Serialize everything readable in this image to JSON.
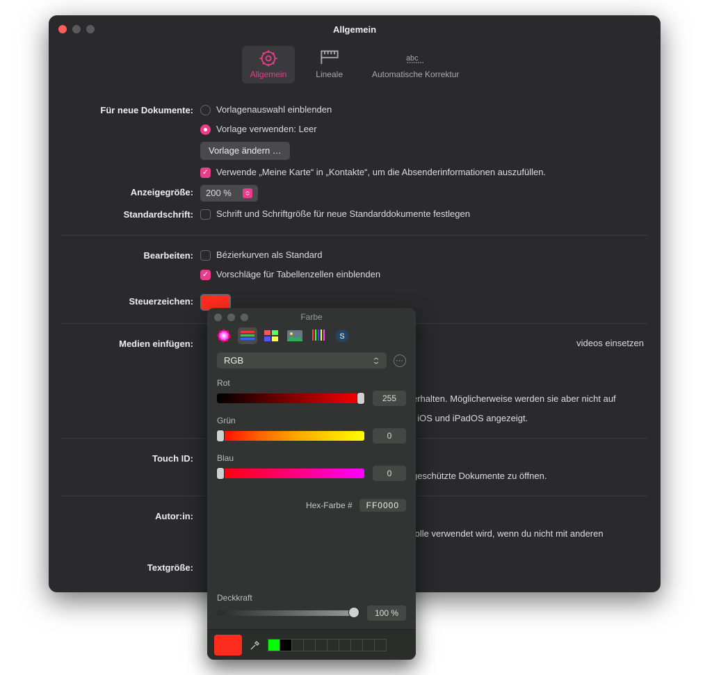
{
  "window": {
    "title": "Allgemein",
    "tabs": [
      {
        "id": "general",
        "label": "Allgemein"
      },
      {
        "id": "rulers",
        "label": "Lineale"
      },
      {
        "id": "autocorr",
        "label": "Automatische Korrektur"
      }
    ],
    "sections": {
      "newdocs": {
        "label": "Für neue Dokumente:",
        "radio_show_chooser": "Vorlagenauswahl einblenden",
        "radio_use_template": "Vorlage verwenden: Leer",
        "change_template_btn": "Vorlage ändern …",
        "use_mycard_label": "Verwende „Meine Karte“ in „Kontakte“, um die Absenderinformationen auszufüllen."
      },
      "zoom": {
        "label": "Anzeigegröße:",
        "value": "200 %"
      },
      "defaultfont": {
        "label": "Standardschrift:",
        "check_label": "Schrift und Schriftgröße für neue Standarddokumente festlegen"
      },
      "edit": {
        "label": "Bearbeiten:",
        "bezier": "Bézierkurven als Standard",
        "suggest": "Vorschläge für Tabellenzellen einblenden"
      },
      "invisibles": {
        "label": "Steuerzeichen:",
        "swatch_hex": "#ff2d1e"
      },
      "media": {
        "label": "Medien einfügen:",
        "tail1": "videos einsetzen",
        "tail2": "erhalten. Möglicherweise werden sie aber nicht auf",
        "tail3": ", iOS und iPadOS angezeigt."
      },
      "touchid": {
        "label": "Touch ID:",
        "tail": "geschützte Dokumente zu öffnen."
      },
      "author": {
        "label": "Autor:in:",
        "tail": "folle verwendet wird, wenn du nicht mit anderen"
      },
      "textsize": {
        "label": "Textgröße:"
      }
    }
  },
  "colorpanel": {
    "title": "Farbe",
    "model": "RGB",
    "channels": {
      "red": {
        "label": "Rot",
        "value": "255"
      },
      "green": {
        "label": "Grün",
        "value": "0"
      },
      "blue": {
        "label": "Blau",
        "value": "0"
      }
    },
    "hex_label": "Hex-Farbe #",
    "hex_value": "FF0000",
    "opacity": {
      "label": "Deckkraft",
      "value": "100 %"
    },
    "current_color": "#ff2d1e",
    "recent_colors": [
      "#00ff00",
      "#000000"
    ]
  }
}
